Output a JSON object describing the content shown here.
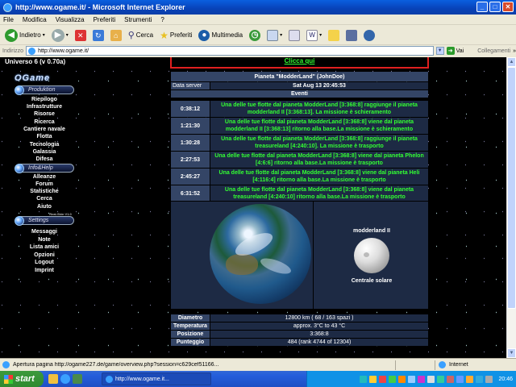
{
  "window": {
    "title": "http://www.ogame.it/ - Microsoft Internet Explorer"
  },
  "menu": [
    "File",
    "Modifica",
    "Visualizza",
    "Preferiti",
    "Strumenti",
    "?"
  ],
  "toolbar": {
    "back": "Indietro",
    "search": "Cerca",
    "favorites": "Preferiti",
    "media": "Multimedia"
  },
  "address": {
    "label": "Indirizzo",
    "url": "http://www.ogame.it/",
    "go": "Vai",
    "links": "Collegamenti"
  },
  "left": {
    "universe": "Universo 6 (v 0.70a)",
    "logo": "OGame",
    "sections": {
      "production": "Produktion",
      "info": "Info&Help",
      "settings": "Settings"
    },
    "nav1": [
      "Riepilogo",
      "Infrastrutture",
      "Risorse",
      "Ricerca",
      "Cantiere navale",
      "Flotta",
      "Tecnologia",
      "Galassia",
      "Difesa"
    ],
    "nav2": [
      "Alleanze",
      "Forum",
      "Statistiche",
      "Cerca",
      "Aiuto"
    ],
    "skin_note": "Real-Skin V1.0",
    "nav3": [
      "Messaggi",
      "Note",
      "Lista amici",
      "Opzioni",
      "Logout",
      "Imprint"
    ]
  },
  "main": {
    "clicca": "Clicca qui",
    "planet_title": "Pianeta \"ModderLand\" (JohnDoe)",
    "server_label": "Data server",
    "server_time": "Sat Aug 13 20:45:53",
    "events_label": "Eventi",
    "events": [
      {
        "time": "0:38:12",
        "text": "Una delle tue flotte dal pianeta ModderLand [3:368:8] raggiunge il pianeta modderland II [3:368:13]. La missione è schieramento"
      },
      {
        "time": "1:21:30",
        "text": "Una delle tue flotte dal pianeta ModderLand [3:368:8] viene dal pianeta modderland II [3:368:13] ritorno alla base.La missione è schieramento"
      },
      {
        "time": "1:30:28",
        "text": "Una delle tue flotte dal pianeta ModderLand [3:368:8] raggiunge il pianeta treasureland [4:240:10]. La missione è trasporto"
      },
      {
        "time": "2:27:53",
        "text": "Una delle tue flotte dal pianeta ModderLand [3:368:8] viene dal pianeta Phelon [4:6:6] ritorno alla base.La missione è trasporto"
      },
      {
        "time": "2:45:27",
        "text": "Una delle tue flotte dal pianeta ModderLand [3:368:8] viene dal pianeta Heli [4:116:4] ritorno alla base.La missione è trasporto"
      },
      {
        "time": "6:31:52",
        "text": "Una delle tue flotte dal pianeta ModderLand [3:368:8] viene dal pianeta treasureland [4:240:10] ritorno alla base.La missione è trasporto"
      }
    ],
    "moon_name": "modderland II",
    "moon_label": "Centrale solare",
    "stats": [
      {
        "label": "Diametro",
        "value": "12800 km ( 68 / 163 spazi )"
      },
      {
        "label": "Temperatura",
        "value": "approx. 3°C to 43 °C"
      },
      {
        "label": "Posizione",
        "value": "3:368:8"
      },
      {
        "label": "Punteggio",
        "value": "484 (rank 4744 of 12304)"
      }
    ]
  },
  "status": {
    "text": "Apertura pagina http://ogame227.de/game/overview.php?session=c629cef51166...",
    "zone": "Internet"
  },
  "taskbar": {
    "start": "start",
    "task": "http://www.ogame.it...",
    "clock": "20:46"
  }
}
